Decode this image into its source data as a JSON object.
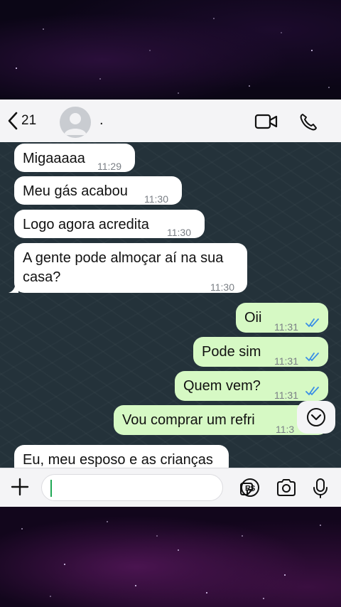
{
  "header": {
    "back_count": "21",
    "contact_name": "."
  },
  "messages": [
    {
      "direction": "in",
      "text": "Migaaaaa",
      "time": "11:29"
    },
    {
      "direction": "in",
      "text": "Meu gás acabou",
      "time": "11:30"
    },
    {
      "direction": "in",
      "text": "Logo agora acredita",
      "time": "11:30"
    },
    {
      "direction": "in",
      "text_line1": "A gente pode almoçar aí na sua",
      "text_line2": "casa?",
      "time": "11:30"
    },
    {
      "direction": "out",
      "text": "Oii",
      "time": "11:31",
      "status": "read"
    },
    {
      "direction": "out",
      "text": "Pode sim",
      "time": "11:31",
      "status": "read"
    },
    {
      "direction": "out",
      "text": "Quem vem?",
      "time": "11:31",
      "status": "read"
    },
    {
      "direction": "out",
      "text": "Vou comprar um refri",
      "time": "11:3"
    },
    {
      "direction": "in",
      "text": "Eu, meu esposo e as crianças"
    }
  ],
  "composer": {
    "input_value": "",
    "currency_label": "R$"
  },
  "icons": {
    "back": "chevron-left-icon",
    "avatar": "person-icon",
    "video": "video-camera-icon",
    "call": "phone-icon",
    "attach": "plus-icon",
    "sticker": "sticker-icon",
    "payment": "currency-icon",
    "camera": "camera-icon",
    "mic": "microphone-icon",
    "scroll": "chevron-down-icon"
  },
  "colors": {
    "incoming_bubble": "#ffffff",
    "outgoing_bubble": "#d6f9c4",
    "read_ticks": "#3a8ee6",
    "chat_background": "#24323a"
  }
}
